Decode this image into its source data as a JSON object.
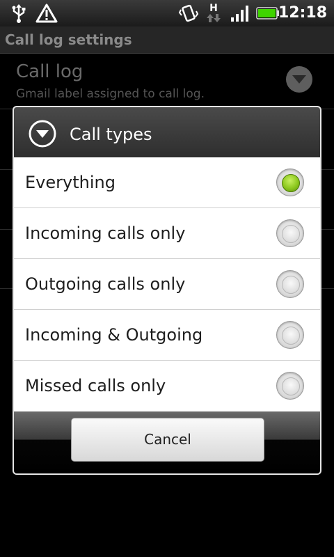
{
  "status_bar": {
    "time": "12:18",
    "data_type": "H",
    "icons": [
      "usb-icon",
      "warning-icon",
      "vibrate-icon",
      "data-transfer-icon",
      "signal-icon",
      "battery-icon"
    ],
    "battery_color": "#3fd400"
  },
  "screen": {
    "title": "Call log settings"
  },
  "background_list": {
    "item": {
      "title": "Call log",
      "subtitle": "Gmail label assigned to call log."
    }
  },
  "dialog": {
    "title": "Call types",
    "options": [
      {
        "label": "Everything",
        "checked": true
      },
      {
        "label": "Incoming calls only",
        "checked": false
      },
      {
        "label": "Outgoing calls only",
        "checked": false
      },
      {
        "label": "Incoming & Outgoing",
        "checked": false
      },
      {
        "label": "Missed calls only",
        "checked": false
      }
    ],
    "cancel_label": "Cancel",
    "accent_color": "#8cc81e"
  }
}
